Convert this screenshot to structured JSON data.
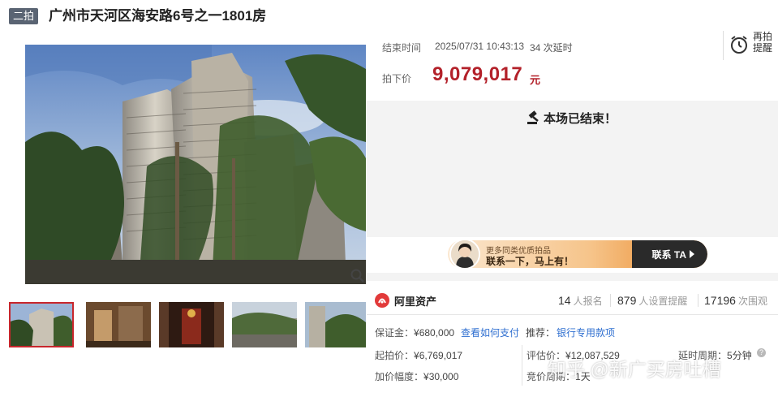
{
  "header": {
    "badge": "二拍",
    "title": "广州市天河区海安路6号之一1801房"
  },
  "auction": {
    "end_label": "结束时间",
    "end_time": "2025/07/31 10:43:13",
    "delay_text": "34 次延时",
    "remind_label_1": "再拍",
    "remind_label_2": "提醒",
    "price_label": "拍下价",
    "price_value": "9,079,017",
    "price_unit": "元",
    "ended_text": "本场已结束！"
  },
  "contact": {
    "small_text": "更多同类优质拍品",
    "main_text": "联系一下，马上有！",
    "button_label": "联系 TA"
  },
  "stats": {
    "platform": "阿里资产",
    "signup_count": "14",
    "signup_label": "人报名",
    "reminder_count": "879",
    "reminder_label": "人设置提醒",
    "view_count": "17196",
    "view_label": "次围观"
  },
  "details": {
    "deposit_label": "保证金：",
    "deposit_value": "¥680,000",
    "deposit_link": "查看如何支付",
    "recommend_label": "推荐：",
    "recommend_link": "银行专用款项",
    "start_price_label": "起拍价：",
    "start_price_value": "¥6,769,017",
    "valuation_label": "评估价：",
    "valuation_value": "¥12,087,529",
    "delay_period_label": "延时周期：",
    "delay_period_value": "5分钟",
    "increment_label": "加价幅度：",
    "increment_value": "¥30,000",
    "bid_period_label": "竞价周期：",
    "bid_period_value": "1天"
  },
  "watermark": "知乎 @新广买房吐槽",
  "colors": {
    "price_red": "#b3212a",
    "badge_bg": "#5a6473",
    "link_blue": "#2f6fd0",
    "active_thumb_border": "#c8262c"
  }
}
